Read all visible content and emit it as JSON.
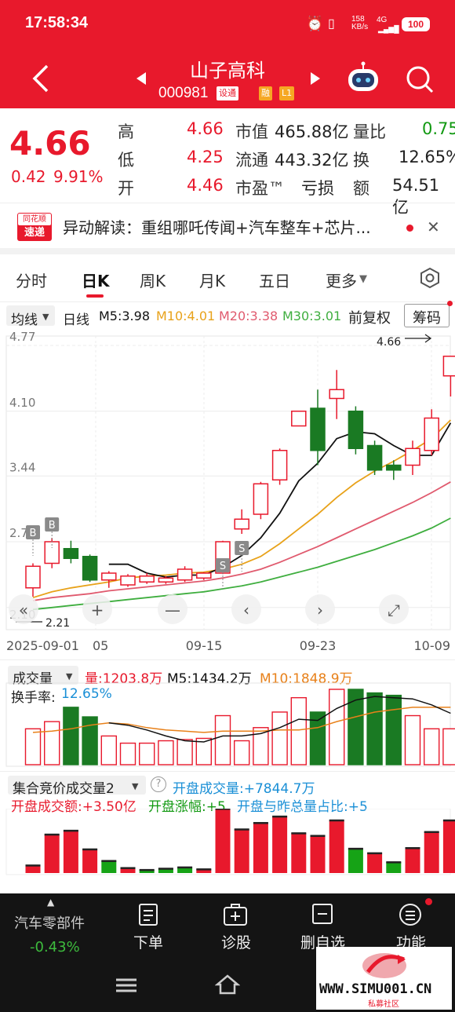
{
  "status": {
    "time": "17:58:34",
    "speed": "158",
    "speed_unit": "KB/s",
    "net": "4G",
    "battery": "100"
  },
  "header": {
    "title": "山子高科",
    "code": "000981",
    "tag1": "设通",
    "tag2": "融",
    "tag3": "L1"
  },
  "quote": {
    "price": "4.66",
    "change": "0.42",
    "change_pct": "9.91%",
    "fields": [
      {
        "label": "高",
        "value": "4.66"
      },
      {
        "label": "低",
        "value": "4.25"
      },
      {
        "label": "开",
        "value": "4.46"
      },
      {
        "label": "市值",
        "value": "465.88亿"
      },
      {
        "label": "流通",
        "value": "443.32亿"
      },
      {
        "label": "市盈™",
        "value": "亏损"
      },
      {
        "label": "量比",
        "value": "0.75"
      },
      {
        "label": "换",
        "value": "12.65%"
      },
      {
        "label": "额",
        "value": "54.51亿"
      }
    ]
  },
  "news": {
    "logo_top": "同花顺",
    "logo_bottom": "速递",
    "text": "异动解读：重组哪吒传闻+汽车整车+芯片..."
  },
  "tabs": [
    "分时",
    "日K",
    "周K",
    "月K",
    "五日",
    "更多"
  ],
  "indicator": {
    "ma_type": "均线",
    "period": "日线",
    "m5": "M5:3.98",
    "m10": "M10:4.01",
    "m20": "M20:3.38",
    "m30": "M30:3.01",
    "adjust": "前复权",
    "chips": "筹码"
  },
  "colors": {
    "up": "#e8192c",
    "down": "#1a7a23",
    "m5": "#111111",
    "m10": "#e8a21a",
    "m20": "#e05a6e",
    "m30": "#3fae3f",
    "accent": "#e8192c"
  },
  "chart_data": [
    {
      "type": "candlestick",
      "title": "日K",
      "x": [
        "09-01",
        "09-02",
        "09-03",
        "09-04",
        "09-05",
        "09-08",
        "09-09",
        "09-10",
        "09-11",
        "09-12",
        "09-15",
        "09-16",
        "09-17",
        "09-18",
        "09-19",
        "09-22",
        "09-23",
        "09-24",
        "09-25",
        "09-26",
        "09-29",
        "09-30",
        "10-09"
      ],
      "open": [
        2.3,
        2.55,
        2.7,
        2.62,
        2.38,
        2.33,
        2.36,
        2.36,
        2.38,
        2.4,
        2.45,
        2.9,
        3.05,
        3.4,
        3.95,
        4.13,
        4.23,
        4.1,
        3.75,
        3.55,
        3.55,
        3.7,
        4.46
      ],
      "close": [
        2.52,
        2.77,
        2.6,
        2.38,
        2.45,
        2.42,
        2.42,
        2.4,
        2.49,
        2.45,
        2.77,
        3.0,
        3.36,
        3.7,
        4.1,
        3.7,
        4.32,
        3.72,
        3.5,
        3.5,
        3.72,
        4.03,
        4.66
      ],
      "high": [
        2.55,
        2.81,
        2.78,
        2.64,
        2.47,
        2.44,
        2.45,
        2.42,
        2.52,
        2.46,
        2.78,
        3.1,
        3.38,
        3.72,
        4.1,
        4.32,
        4.52,
        4.15,
        3.8,
        3.6,
        3.8,
        4.12,
        4.66
      ],
      "low": [
        2.21,
        2.5,
        2.55,
        2.36,
        2.3,
        2.31,
        2.34,
        2.34,
        2.36,
        2.38,
        2.44,
        2.85,
        3.0,
        3.35,
        3.95,
        3.55,
        4.02,
        3.66,
        3.45,
        3.4,
        3.45,
        3.65,
        4.25
      ],
      "ylim": [
        2.05,
        4.77
      ],
      "y_ticks": [
        "4.77",
        "4.10",
        "3.44",
        "2.77",
        "2.10"
      ],
      "x_ticks": [
        "2025-09-01",
        "05",
        "09-15",
        "09-23",
        "10-09"
      ],
      "annotations": [
        "4.66",
        "2.21",
        "B",
        "S",
        "B",
        "S"
      ],
      "ma_legend": [
        "M5:3.98",
        "M10:4.01",
        "M20:3.38",
        "M30:3.01"
      ],
      "m5": [
        null,
        null,
        null,
        null,
        2.54,
        2.54,
        2.45,
        2.41,
        2.43,
        2.43,
        2.51,
        2.63,
        2.81,
        3.06,
        3.39,
        3.57,
        3.82,
        3.89,
        3.87,
        3.75,
        3.65,
        3.65,
        3.98
      ],
      "m10": [
        2.2,
        2.26,
        2.3,
        2.33,
        2.36,
        2.4,
        2.42,
        2.43,
        2.45,
        2.46,
        2.49,
        2.54,
        2.62,
        2.75,
        2.9,
        3.05,
        3.22,
        3.37,
        3.49,
        3.59,
        3.7,
        3.82,
        4.01
      ],
      "m20": [
        2.17,
        2.2,
        2.22,
        2.24,
        2.27,
        2.29,
        2.31,
        2.33,
        2.35,
        2.37,
        2.4,
        2.44,
        2.49,
        2.56,
        2.64,
        2.72,
        2.81,
        2.9,
        2.99,
        3.08,
        3.17,
        3.27,
        3.38
      ],
      "m30": [
        2.08,
        2.1,
        2.12,
        2.14,
        2.16,
        2.18,
        2.2,
        2.22,
        2.24,
        2.26,
        2.29,
        2.32,
        2.36,
        2.41,
        2.46,
        2.51,
        2.57,
        2.63,
        2.69,
        2.76,
        2.83,
        2.91,
        3.01
      ]
    },
    {
      "type": "bar",
      "title": "成交量",
      "label": "量:1203.8万",
      "ma5": "M5:1434.2万",
      "ma10": "M10:1848.9万",
      "turnover_label": "换手率:",
      "turnover": "12.65%",
      "values": [
        30,
        36,
        48,
        40,
        24,
        18,
        18,
        20,
        21,
        22,
        41,
        20,
        31,
        44,
        56,
        44,
        63,
        63,
        60,
        58,
        41,
        30,
        30
      ],
      "ma5_line": [
        null,
        null,
        null,
        null,
        35,
        33,
        29,
        24,
        20,
        19,
        24,
        24,
        26,
        31,
        38,
        37,
        47,
        54,
        57,
        56,
        55,
        50,
        43
      ],
      "ma10_line": [
        27,
        28,
        30,
        33,
        35,
        34,
        31,
        29,
        28,
        27,
        28,
        28,
        28,
        29,
        29,
        31,
        36,
        40,
        44,
        46,
        48,
        48,
        48
      ]
    },
    {
      "type": "bar",
      "title": "集合竞价成交量2",
      "open_vol": "开盘成交量:+7844.7万",
      "open_amt": "开盘成交额:+3.50亿",
      "open_rise": "开盘涨幅:+5",
      "open_ratio": "开盘与昨总量占比:+5",
      "values": [
        12,
        60,
        66,
        37,
        19,
        8,
        5,
        7,
        9,
        6,
        100,
        68,
        78,
        88,
        62,
        58,
        82,
        38,
        31,
        17,
        39,
        64,
        82
      ],
      "up": [
        1,
        1,
        1,
        1,
        0,
        1,
        0,
        0,
        0,
        1,
        1,
        1,
        1,
        1,
        1,
        1,
        1,
        0,
        1,
        0,
        1,
        1,
        1
      ]
    }
  ],
  "bottom": {
    "sector": "汽车零部件",
    "sector_change": "-0.43%",
    "order": "下单",
    "diagnose": "诊股",
    "delete": "删自选",
    "function": "功能"
  },
  "watermark": {
    "site": "WWW.SIMU001.CN",
    "sub": "私募社区"
  }
}
